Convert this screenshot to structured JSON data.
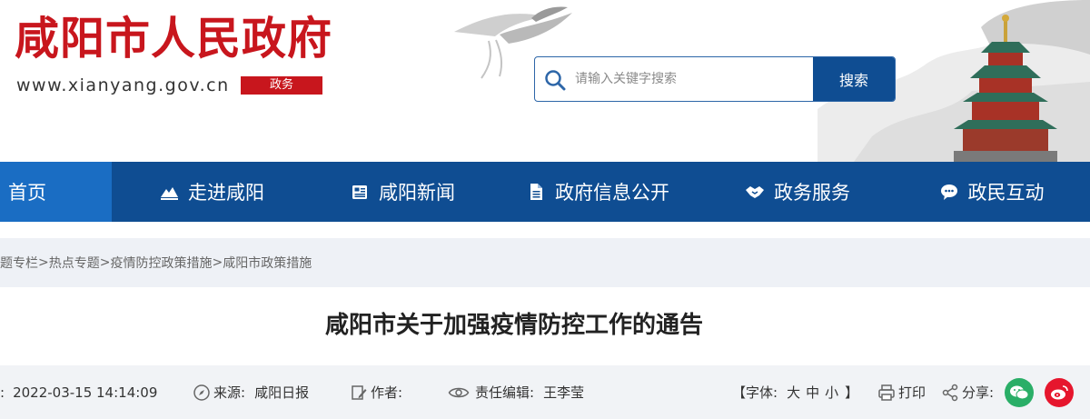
{
  "header": {
    "site_title": "咸阳市人民政府",
    "site_url": "www.xianyang.gov.cn",
    "section_badge": "政务"
  },
  "search": {
    "placeholder": "请输入关键字搜索",
    "button_label": "搜索"
  },
  "nav": {
    "items": [
      {
        "label": "首页",
        "icon": ""
      },
      {
        "label": "走进咸阳",
        "icon": "mountain-icon"
      },
      {
        "label": "咸阳新闻",
        "icon": "newspaper-icon"
      },
      {
        "label": "政府信息公开",
        "icon": "document-icon"
      },
      {
        "label": "政务服务",
        "icon": "handshake-icon"
      },
      {
        "label": "政民互动",
        "icon": "chat-icon"
      }
    ]
  },
  "breadcrumb": {
    "items": [
      "题专栏",
      "热点专题",
      "疫情防控政策措施",
      "咸阳市政策措施"
    ],
    "separator": ">"
  },
  "article": {
    "title": "咸阳市关于加强疫情防控工作的通告",
    "date_prefix": ":",
    "date": "2022-03-15 14:14:09",
    "source_label": "来源:",
    "source": "咸阳日报",
    "author_label": "作者:",
    "author": "",
    "editor_label": "责任编辑:",
    "editor": "王李莹",
    "font_open": "【字体:",
    "font_large": "大",
    "font_medium": "中",
    "font_small": "小",
    "font_close": "】",
    "print_label": "打印",
    "share_label": "分享:"
  },
  "colors": {
    "brand_red": "#c8161d",
    "nav_blue": "#0f4d92",
    "nav_active": "#1a6dc3",
    "wechat_green": "#2aae67",
    "weibo_red": "#e6162d"
  }
}
